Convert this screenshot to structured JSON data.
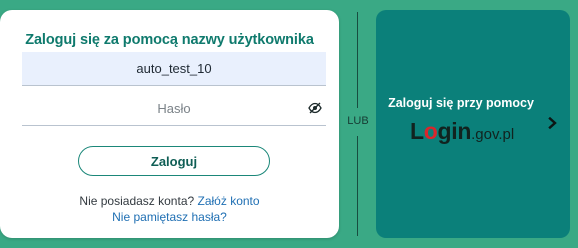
{
  "login_card": {
    "title": "Zaloguj się za pomocą nazwy użytkownika",
    "username_value": "auto_test_10",
    "password_placeholder": "Hasło",
    "login_button_label": "Zaloguj",
    "no_account_text": "Nie posiadasz konta?",
    "register_link_label": "Załóż konto",
    "forgot_password_label": "Nie pamiętasz hasła?"
  },
  "divider_label": "LUB",
  "gov_panel": {
    "text": "Zaloguj się przy pomocy",
    "logo_text": "login.gov.pl"
  },
  "icons": {
    "password_toggle": "eye-slash-icon",
    "gov_panel_arrow": "chevron-right-icon"
  },
  "colors": {
    "background": "#3aa985",
    "title": "#0f7a6d",
    "gov_panel": "#0b807a",
    "link": "#1f6fb3",
    "logo_accent": "#d8262c"
  }
}
